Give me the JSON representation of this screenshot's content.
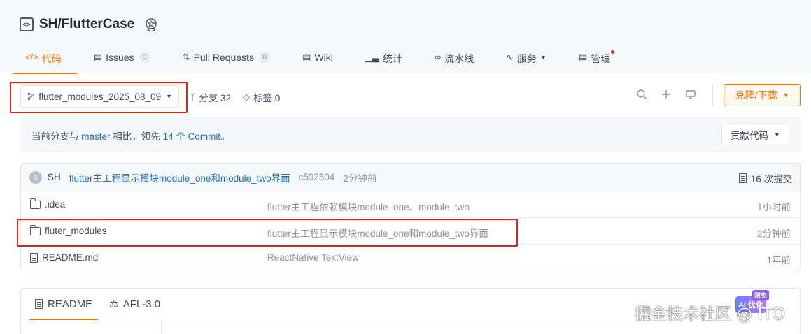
{
  "repo": {
    "title": "SH/FlutterCase"
  },
  "tabs": [
    {
      "label": "代码",
      "icon": "code-icon",
      "active": true
    },
    {
      "label": "Issues",
      "count": "0",
      "icon": "issues-icon"
    },
    {
      "label": "Pull Requests",
      "count": "0",
      "icon": "pull-request-icon"
    },
    {
      "label": "Wiki",
      "icon": "wiki-icon"
    },
    {
      "label": "统计",
      "icon": "stats-icon"
    },
    {
      "label": "流水线",
      "icon": "pipeline-icon"
    },
    {
      "label": "服务",
      "icon": "service-icon",
      "dropdown": true
    },
    {
      "label": "管理",
      "icon": "manage-icon",
      "notification": true
    }
  ],
  "toolbar": {
    "branch": "flutter_modules_2025_08_09",
    "branches_label": "分支 32",
    "tags_label": "标签 0",
    "clone_label": "克隆/下载"
  },
  "compare": {
    "prefix": "当前分支与",
    "base_branch": "master",
    "middle": "相比，领先",
    "ahead": "14 个 Commit",
    "suffix": "。",
    "contribute_label": "贡献代码"
  },
  "latest_commit": {
    "avatar_letter": "S",
    "author": "SH",
    "message": "flutter主工程显示模块module_one和module_two界面",
    "sha": "c592504",
    "time": "2分钟前",
    "commits_label": "16 次提交"
  },
  "files": [
    {
      "name": ".idea",
      "type": "folder",
      "message": "flutter主工程依赖模块module_one、module_two",
      "time": "1小时前"
    },
    {
      "name": "fluter_modules",
      "type": "folder",
      "message": "flutter主工程显示模块module_one和module_two界面",
      "time": "2分钟前"
    },
    {
      "name": "README.md",
      "type": "file",
      "message": "ReactNative TextView",
      "time": "1年前"
    }
  ],
  "readme": {
    "tab_readme": "README",
    "tab_license": "AFL-3.0",
    "ai_label": "AI 优化",
    "ai_free": "限免"
  },
  "watermark": "掘金技术社区 @ ITO",
  "colors": {
    "accent": "#fe7300",
    "link": "#1f72c5",
    "highlight_box": "#d9261c"
  }
}
